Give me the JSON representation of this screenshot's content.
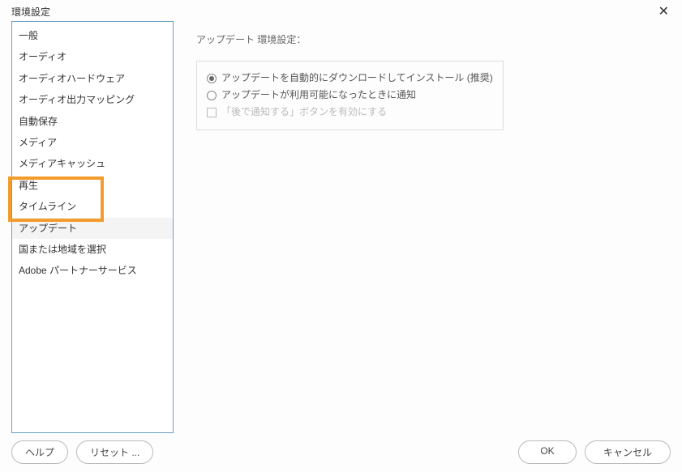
{
  "title": "環境設定",
  "sidebar": {
    "items": [
      {
        "label": "一般"
      },
      {
        "label": "オーディオ"
      },
      {
        "label": "オーディオハードウェア"
      },
      {
        "label": "オーディオ出力マッピング"
      },
      {
        "label": "自動保存"
      },
      {
        "label": "メディア"
      },
      {
        "label": "メディアキャッシュ"
      },
      {
        "label": "再生"
      },
      {
        "label": "タイムライン"
      },
      {
        "label": "アップデート"
      },
      {
        "label": "国または地域を選択"
      },
      {
        "label": "Adobe パートナーサービス"
      }
    ]
  },
  "main": {
    "section_title": "アップデート 環境設定：",
    "radio1": "アップデートを自動的にダウンロードしてインストール (推奨)",
    "radio2": "アップデートが利用可能になったときに通知",
    "checkbox1": "「後で通知する」ボタンを有効にする"
  },
  "buttons": {
    "help": "ヘルプ",
    "reset": "リセット ...",
    "ok": "OK",
    "cancel": "キャンセル"
  }
}
